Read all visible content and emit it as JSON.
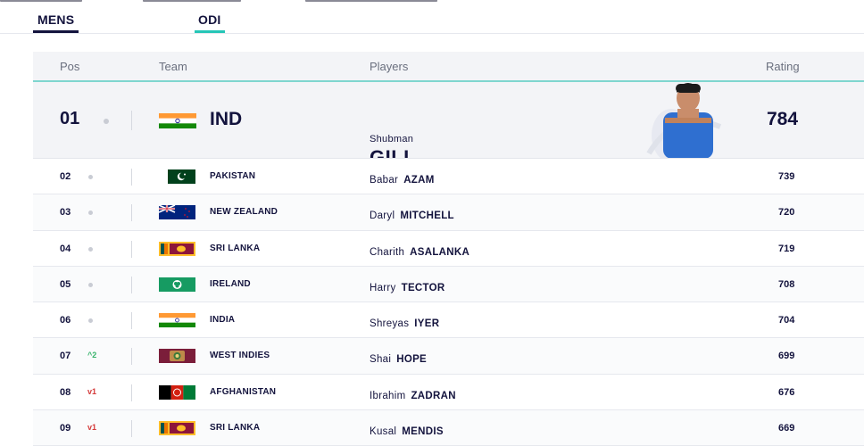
{
  "tabs": [
    {
      "label": "MENS"
    },
    {
      "label": "ODI"
    }
  ],
  "table": {
    "headers": {
      "pos": "Pos",
      "team": "Team",
      "players": "Players",
      "rating": "Rating"
    },
    "top": {
      "pos": "01",
      "team_abbr": "IND",
      "flag": "india-flag",
      "first_name": "Shubman",
      "last_name": "GILL",
      "rating": "784",
      "photo": "player-photo"
    },
    "rows": [
      {
        "pos": "02",
        "movement": "",
        "flag": "pakistan-flag",
        "team": "PAKISTAN",
        "first": "Babar",
        "last": "AZAM",
        "rating": "739"
      },
      {
        "pos": "03",
        "movement": "",
        "flag": "new-zealand-flag",
        "team": "NEW ZEALAND",
        "first": "Daryl",
        "last": "MITCHELL",
        "rating": "720"
      },
      {
        "pos": "04",
        "movement": "",
        "flag": "sri-lanka-flag",
        "team": "SRI LANKA",
        "first": "Charith",
        "last": "ASALANKA",
        "rating": "719"
      },
      {
        "pos": "05",
        "movement": "",
        "flag": "ireland-flag",
        "team": "IRELAND",
        "first": "Harry",
        "last": "TECTOR",
        "rating": "708"
      },
      {
        "pos": "06",
        "movement": "",
        "flag": "india-flag",
        "team": "INDIA",
        "first": "Shreyas",
        "last": "IYER",
        "rating": "704"
      },
      {
        "pos": "07",
        "movement": "^2",
        "flag": "west-indies-flag",
        "team": "WEST INDIES",
        "first": "Shai",
        "last": "HOPE",
        "rating": "699"
      },
      {
        "pos": "08",
        "movement": "v1",
        "flag": "afghanistan-flag",
        "team": "AFGHANISTAN",
        "first": "Ibrahim",
        "last": "ZADRAN",
        "rating": "676"
      },
      {
        "pos": "09",
        "movement": "v1",
        "flag": "sri-lanka-flag",
        "team": "SRI LANKA",
        "first": "Kusal",
        "last": "MENDIS",
        "rating": "669"
      }
    ]
  },
  "colors": {
    "navy": "#13133d",
    "teal": "#25c6b7",
    "up": "#36b36a",
    "down": "#d43a3a"
  }
}
